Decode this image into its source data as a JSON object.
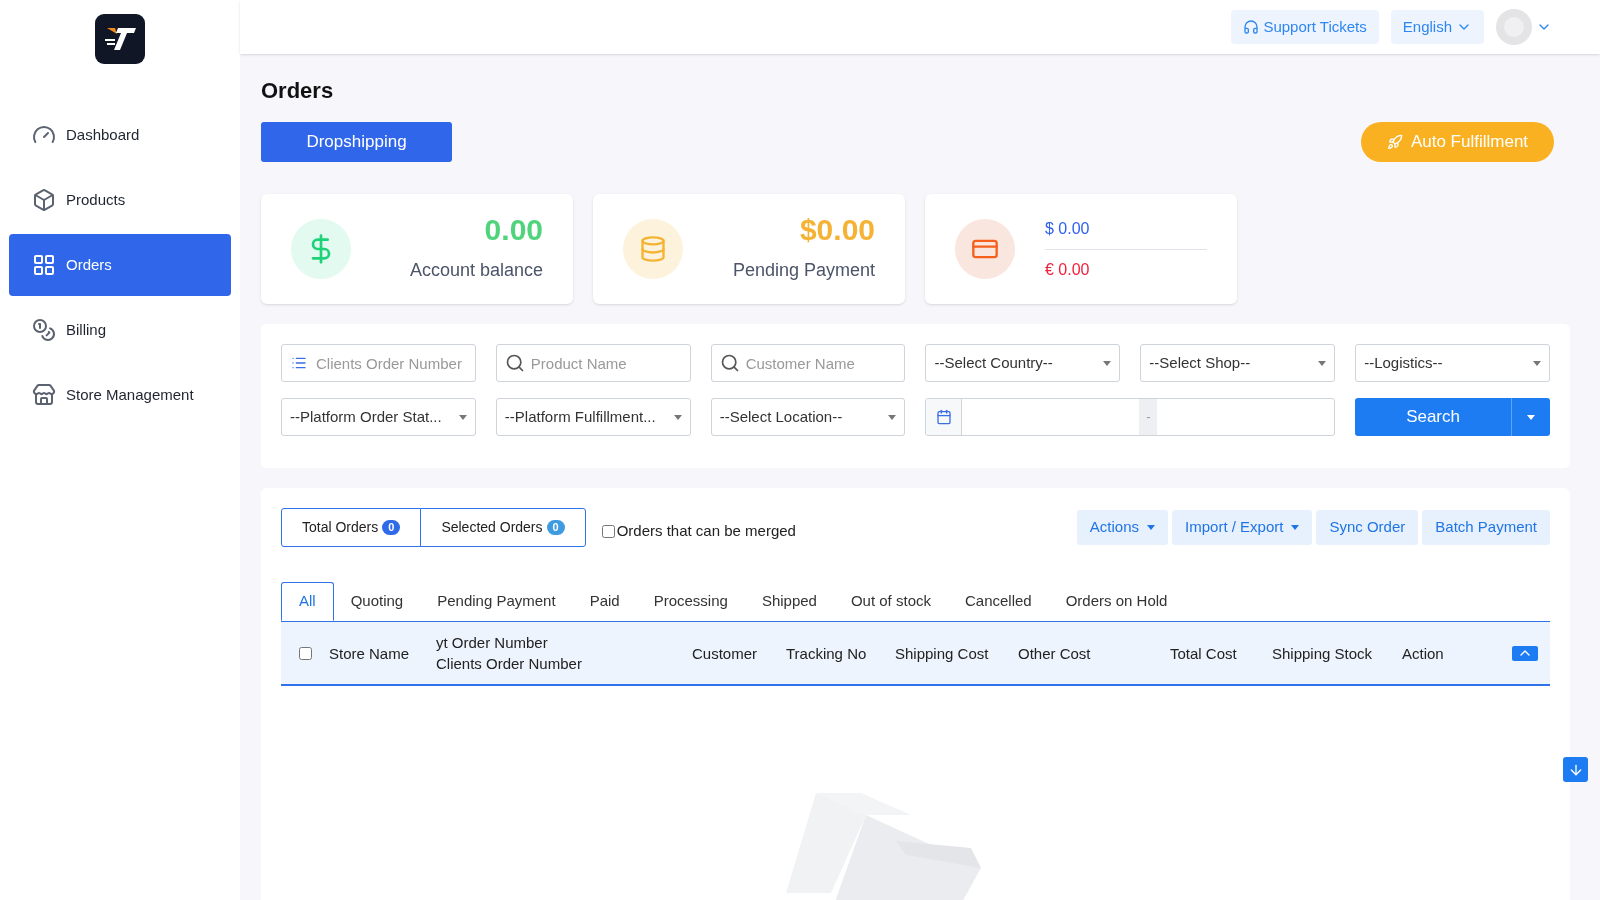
{
  "sidebar": {
    "items": [
      {
        "label": "Dashboard",
        "selected": false
      },
      {
        "label": "Products",
        "selected": false
      },
      {
        "label": "Orders",
        "selected": true
      },
      {
        "label": "Billing",
        "selected": false
      },
      {
        "label": "Store Management",
        "selected": false
      }
    ]
  },
  "header": {
    "support": "Support Tickets",
    "language": "English"
  },
  "page": {
    "title": "Orders",
    "mode_button": "Dropshipping",
    "auto_button": "Auto Fulfillment"
  },
  "stats": [
    {
      "kind": "balance",
      "value": "0.00",
      "label": "Account balance"
    },
    {
      "kind": "pending",
      "value": "$0.00",
      "label": "Pending Payment"
    },
    {
      "kind": "currencies",
      "lines": [
        "$ 0.00",
        "€ 0.00"
      ]
    }
  ],
  "filters": [
    {
      "kind": "list",
      "placeholder": "Clients Order Number"
    },
    {
      "kind": "search",
      "placeholder": "Product Name"
    },
    {
      "kind": "search",
      "placeholder": "Customer Name"
    },
    {
      "kind": "select",
      "value": "--Select Country--"
    },
    {
      "kind": "select",
      "value": "--Select Shop--"
    },
    {
      "kind": "select",
      "value": "--Logistics--"
    },
    {
      "kind": "select",
      "value": "--Platform Order Stat..."
    },
    {
      "kind": "select",
      "value": "--Platform Fulfillment..."
    },
    {
      "kind": "select",
      "value": "--Select Location--"
    },
    {
      "kind": "daterange",
      "separator": "-"
    }
  ],
  "search_button": "Search",
  "counters": [
    {
      "label": "Total Orders",
      "count": "0",
      "color": "#2f6ae8"
    },
    {
      "label": "Selected Orders",
      "count": "0",
      "color": "#3d9be0"
    }
  ],
  "merge": {
    "label": "Orders that can be merged",
    "checked": false
  },
  "actions": [
    {
      "label": "Actions",
      "dropdown": true
    },
    {
      "label": "Import / Export",
      "dropdown": true
    },
    {
      "label": "Sync Order",
      "dropdown": false
    },
    {
      "label": "Batch Payment",
      "dropdown": false
    }
  ],
  "tabs": [
    {
      "label": "All",
      "selected": true
    },
    {
      "label": "Quoting",
      "selected": false
    },
    {
      "label": "Pending Payment",
      "selected": false
    },
    {
      "label": "Paid",
      "selected": false
    },
    {
      "label": "Processing",
      "selected": false
    },
    {
      "label": "Shipped",
      "selected": false
    },
    {
      "label": "Out of stock",
      "selected": false
    },
    {
      "label": "Cancelled",
      "selected": false
    },
    {
      "label": "Orders on Hold",
      "selected": false
    }
  ],
  "table": {
    "select_all": {
      "checked": false
    },
    "columns": [
      {
        "lines": [
          "Store Name"
        ]
      },
      {
        "lines": [
          "yt Order Number",
          "Clients Order Number"
        ]
      },
      {
        "lines": [
          "Customer"
        ]
      },
      {
        "lines": [
          "Tracking No"
        ]
      },
      {
        "lines": [
          "Shipping Cost"
        ]
      },
      {
        "lines": [
          "Other Cost"
        ]
      },
      {
        "lines": [
          "Total Cost"
        ]
      },
      {
        "lines": [
          "Shipping Stock"
        ]
      },
      {
        "lines": [
          "Action"
        ]
      }
    ]
  }
}
